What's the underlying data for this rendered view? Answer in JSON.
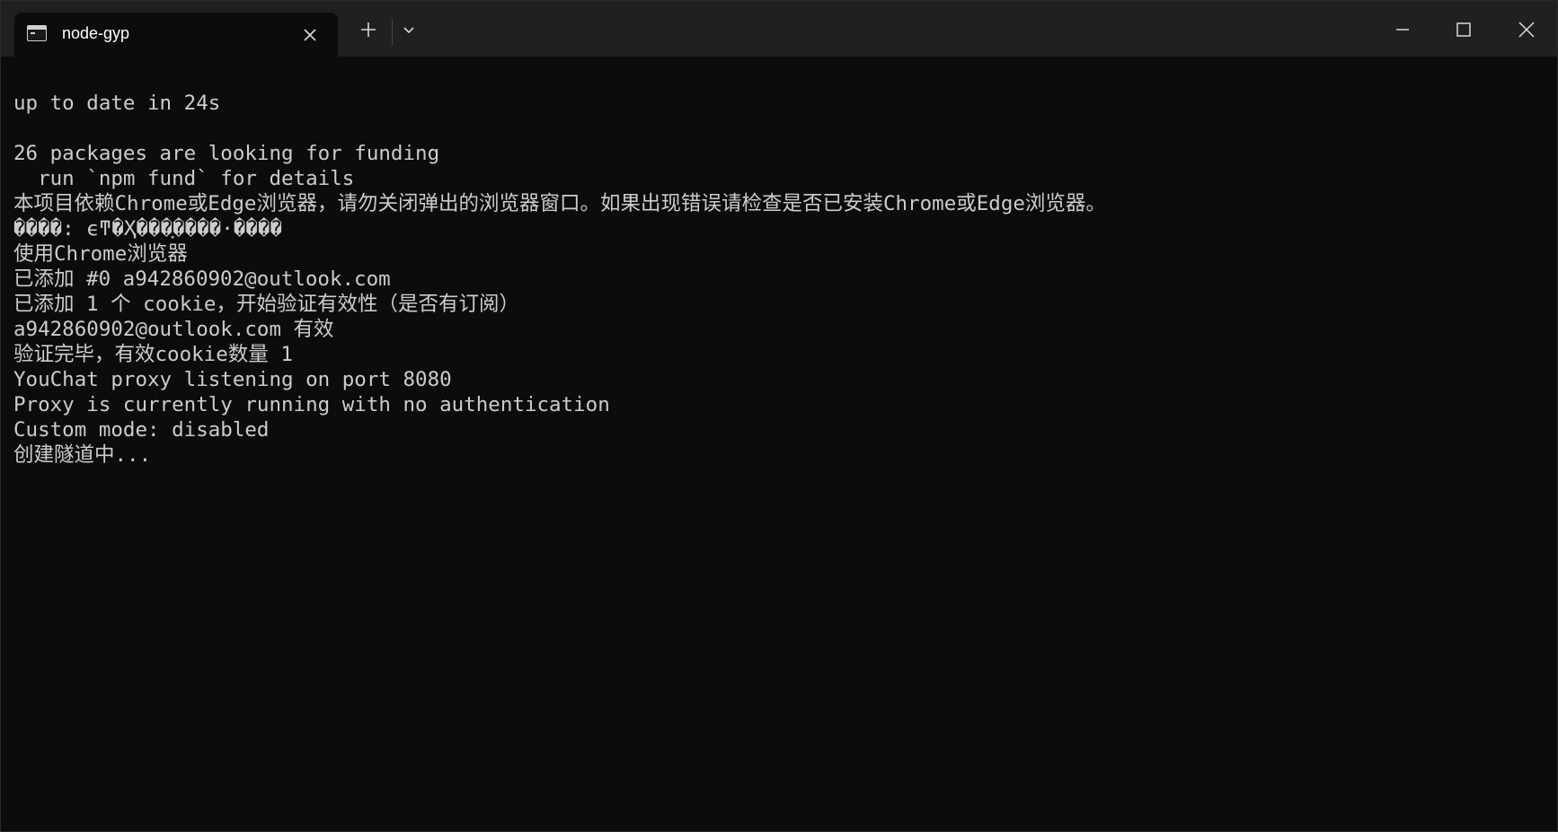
{
  "window": {
    "tab_title": "node-gyp",
    "controls": {
      "new_tab": "new-tab",
      "dropdown": "dropdown",
      "minimize": "minimize",
      "maximize": "maximize",
      "close": "close"
    }
  },
  "terminal": {
    "lines": [
      "up to date in 24s",
      "",
      "26 packages are looking for funding",
      "  run `npm fund` for details",
      "本项目依赖Chrome或Edge浏览器，请勿关闭弹出的浏览器窗口。如果出现错误请检查是否已安装Chrome或Edge浏览器。",
      "����: ϵͳ�Ҳ���ָ����·����",
      "使用Chrome浏览器",
      "已添加 #0 a942860902@outlook.com",
      "已添加 1 个 cookie，开始验证有效性（是否有订阅）",
      "a942860902@outlook.com 有效",
      "验证完毕，有效cookie数量 1",
      "YouChat proxy listening on port 8080",
      "Proxy is currently running with no authentication",
      "Custom mode: disabled",
      "创建隧道中..."
    ]
  },
  "colors": {
    "titlebar": "#202020",
    "terminal_bg": "#0c0c0c",
    "text": "#cccccc",
    "tab_title": "#ffffff"
  }
}
